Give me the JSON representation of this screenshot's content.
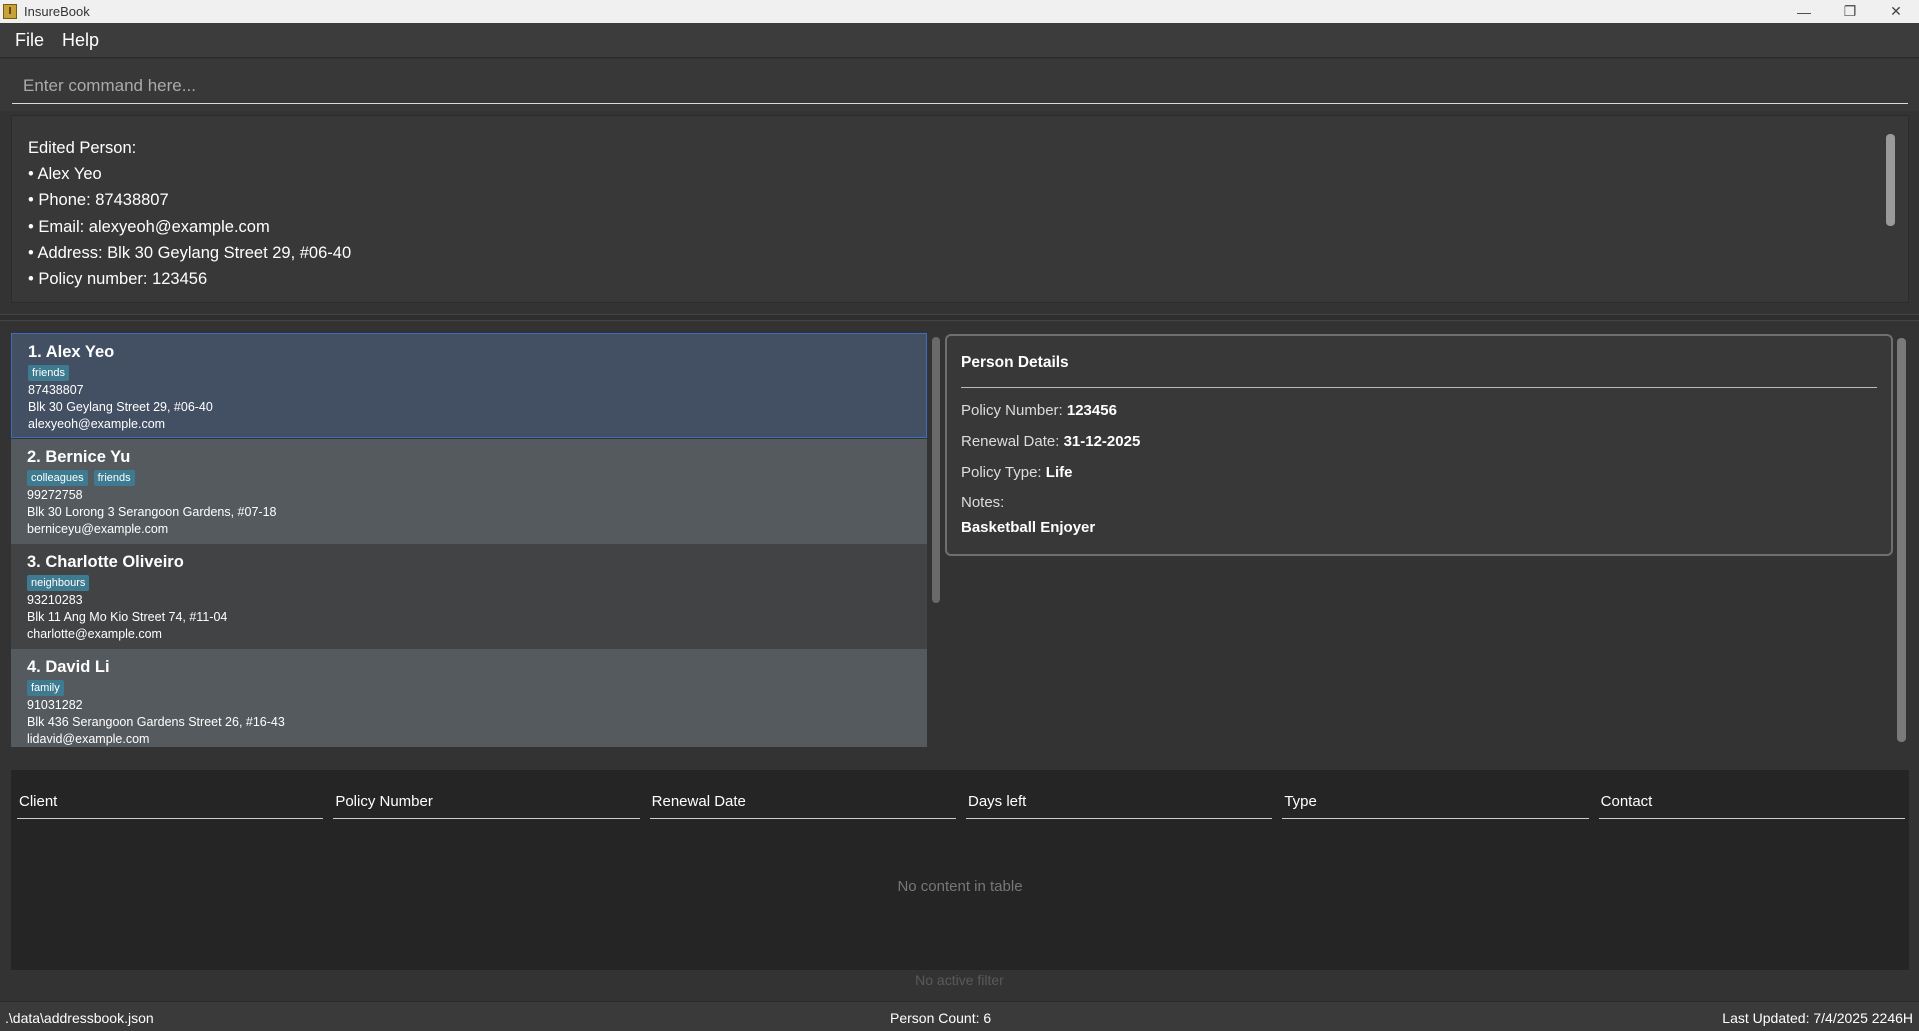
{
  "window": {
    "title": "InsureBook",
    "icon": "app-logo-icon",
    "controls": [
      "minimize-icon",
      "restore-icon",
      "close-icon"
    ]
  },
  "menu": {
    "file": "File",
    "help": "Help"
  },
  "command": {
    "placeholder": "Enter command here..."
  },
  "result": {
    "lines": [
      "Edited Person:",
      "• Alex Yeo",
      "• Phone: 87438807",
      "• Email: alexyeoh@example.com",
      "• Address: Blk 30 Geylang Street 29, #06-40",
      "• Policy number: 123456"
    ]
  },
  "persons": [
    {
      "name": "1. Alex Yeo",
      "tags": [
        "friends"
      ],
      "phone": "87438807",
      "address": "Blk 30 Geylang Street 29, #06-40",
      "email": "alexyeoh@example.com"
    },
    {
      "name": "2. Bernice Yu",
      "tags": [
        "colleagues",
        "friends"
      ],
      "phone": "99272758",
      "address": "Blk 30 Lorong 3 Serangoon Gardens, #07-18",
      "email": "berniceyu@example.com"
    },
    {
      "name": "3. Charlotte Oliveiro",
      "tags": [
        "neighbours"
      ],
      "phone": "93210283",
      "address": "Blk 11 Ang Mo Kio Street 74, #11-04",
      "email": "charlotte@example.com"
    },
    {
      "name": "4. David Li",
      "tags": [
        "family"
      ],
      "phone": "91031282",
      "address": "Blk 436 Serangoon Gardens Street 26, #16-43",
      "email": "lidavid@example.com"
    }
  ],
  "details": {
    "title": "Person Details",
    "policy_number_label": "Policy Number:",
    "policy_number": "123456",
    "renewal_date_label": "Renewal Date:",
    "renewal_date": "31-12-2025",
    "policy_type_label": "Policy Type:",
    "policy_type": "Life",
    "notes_label": "Notes:",
    "notes": "Basketball Enjoyer"
  },
  "table": {
    "headers": [
      "Client",
      "Policy Number",
      "Renewal Date",
      "Days left",
      "Type",
      "Contact"
    ],
    "empty_text": "No content in table",
    "filter_text": "No active filter"
  },
  "status": {
    "file_path": ".\\data\\addressbook.json",
    "person_count": "Person Count: 6",
    "last_updated": "Last Updated: 7/4/2025 2246H"
  },
  "colors": {
    "background": "#333333",
    "selected_card": "#435063",
    "tag": "#3e7b91",
    "table_bg": "#252525"
  }
}
